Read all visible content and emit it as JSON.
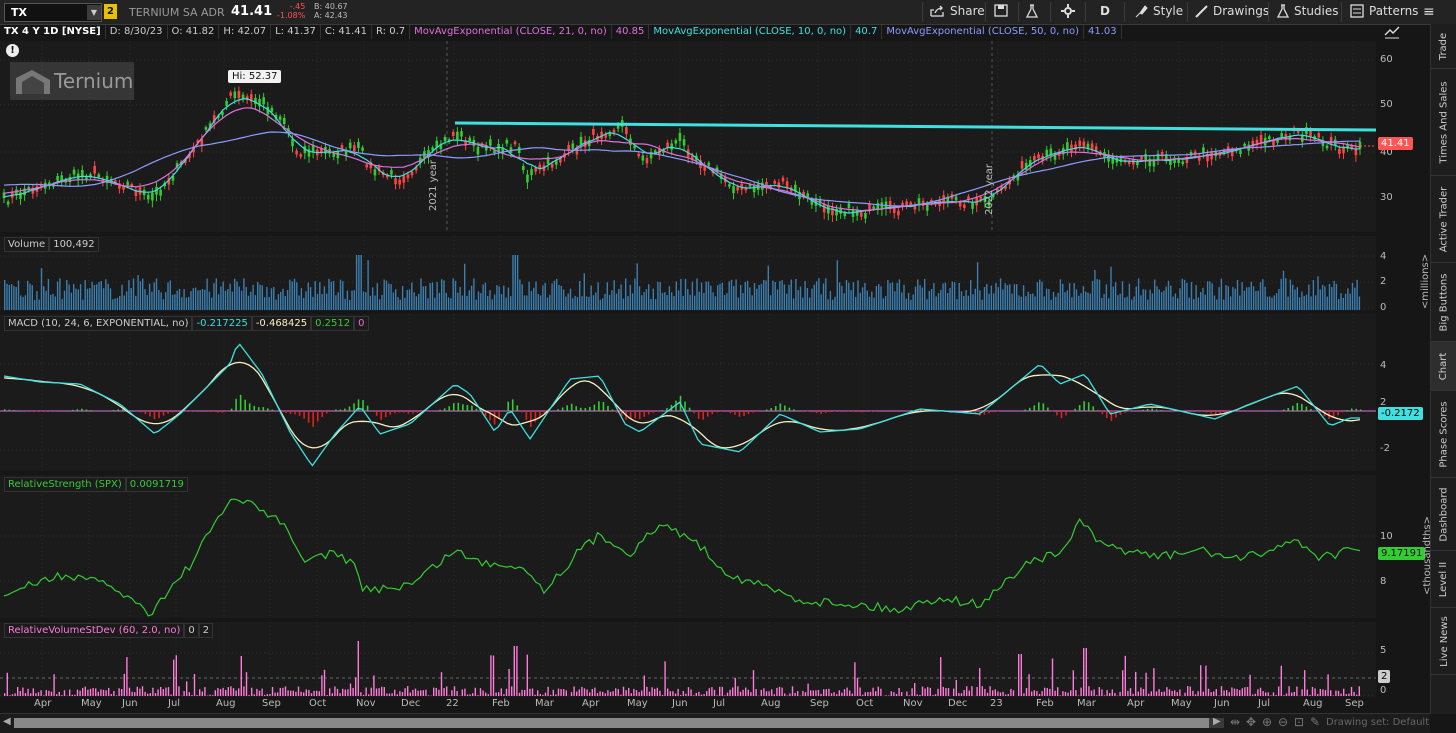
{
  "header": {
    "symbol": "TX",
    "link_badge": "2",
    "company": "TERNIUM SA ADR",
    "last_price": "41.41",
    "change": "-.45",
    "change_pct": "-1.08%",
    "bid": "B: 40.67",
    "ask": "A: 42.43",
    "toolbar": {
      "share": "Share",
      "aggregation": "D",
      "style": "Style",
      "drawings": "Drawings",
      "studies": "Studies",
      "patterns": "Patterns"
    }
  },
  "study_bar": {
    "title": "TX 4 Y 1D [NYSE]",
    "date": "D: 8/30/23",
    "open": "O: 41.82",
    "high": "H: 42.07",
    "low": "L: 41.37",
    "close": "C: 41.41",
    "range": "R: 0.7",
    "ema21_label": "MovAvgExponential (CLOSE, 21, 0, no)",
    "ema21_value": "40.85",
    "ema10_label": "MovAvgExponential (CLOSE, 10, 0, no)",
    "ema10_value": "40.7",
    "ema50_label": "MovAvgExponential (CLOSE, 50, 0, no)",
    "ema50_value": "41.03"
  },
  "price_panel": {
    "alert_icon": "exclamation-icon",
    "logo_text": "Ternium",
    "high_label": "Hi: 52.37",
    "year_markers": [
      "2021 year",
      "2022 year"
    ],
    "y_ticks": [
      "60",
      "50",
      "40",
      "30"
    ],
    "last_marker": "41.41",
    "colors": {
      "resistance": "#3ee0e0",
      "up": "#33cc33",
      "down": "#ff4444",
      "ema21": "#e070e0",
      "ema10": "#3ee0e0",
      "ema50": "#8c9cff"
    }
  },
  "volume_panel": {
    "title": "Volume",
    "value": "100,492",
    "y_ticks": [
      "4",
      "2",
      "0"
    ],
    "unit_label": "<millions>"
  },
  "macd_panel": {
    "title": "MACD (10, 24, 6, EXPONENTIAL, no)",
    "value": "-0.217225",
    "avg": "-0.468425",
    "diff": "0.2512",
    "zero": "0",
    "y_ticks": [
      "4",
      "2",
      "-2"
    ],
    "last_marker": "-0.2172"
  },
  "rs_panel": {
    "title": "RelativeStrength (SPX)",
    "value": "0.0091719",
    "y_ticks": [
      "10",
      "8"
    ],
    "last_marker": "9.17191",
    "unit_label": "<thousandths>"
  },
  "rvol_panel": {
    "title": "RelativeVolumeStDev (60, 2.0, no)",
    "value1": "0",
    "value2": "2",
    "y_ticks": [
      "5",
      "0"
    ],
    "last_marker": "2"
  },
  "x_axis": [
    "Apr",
    "May",
    "Jun",
    "Jul",
    "Aug",
    "Sep",
    "Oct",
    "Nov",
    "Dec",
    "22",
    "Feb",
    "Mar",
    "Apr",
    "May",
    "Jun",
    "Jul",
    "Aug",
    "Sep",
    "Oct",
    "Nov",
    "Dec",
    "23",
    "Feb",
    "Mar",
    "Apr",
    "May",
    "Jun",
    "Jul",
    "Aug",
    "Sep"
  ],
  "footer": {
    "drawing_set": "Drawing set: Default"
  },
  "sidebar": {
    "tabs": [
      "Trade",
      "Times And Sales",
      "Active Trader",
      "Big Buttons",
      "Chart",
      "Phase Scores",
      "Dashboard",
      "Level II",
      "Live News"
    ]
  }
}
